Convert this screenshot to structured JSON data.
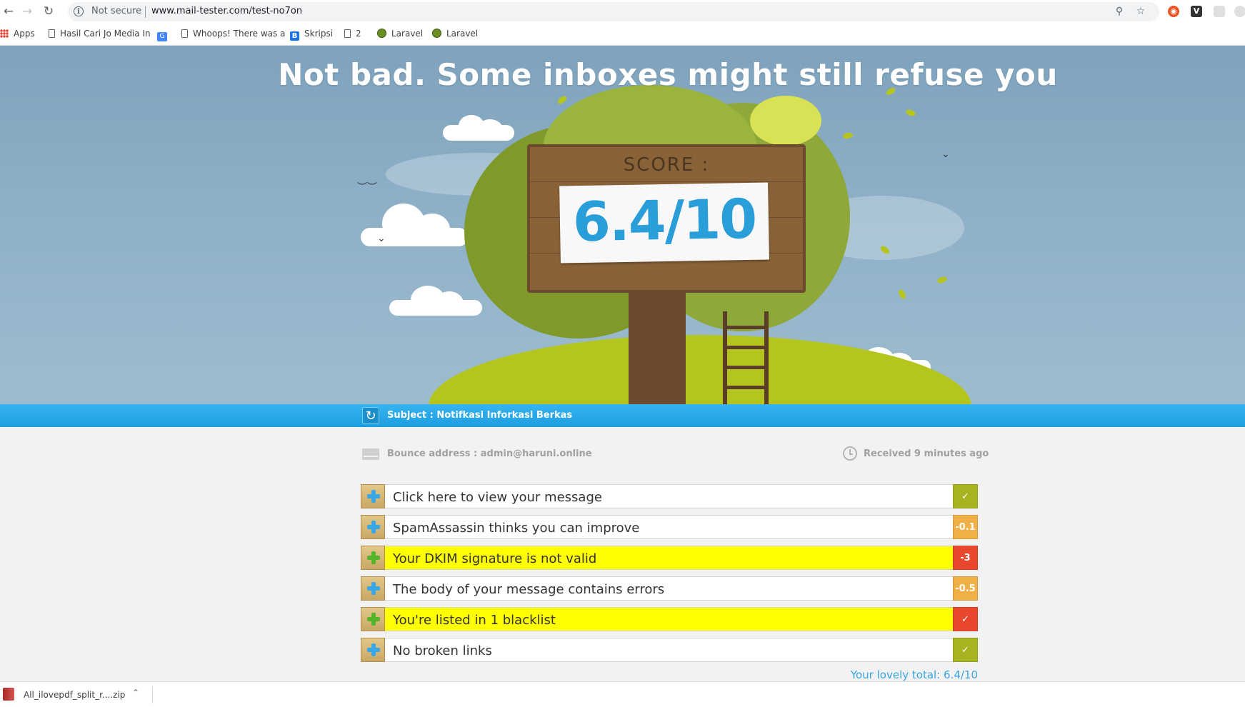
{
  "browser": {
    "security_label": "Not secure",
    "url": "www.mail-tester.com/test-no7on",
    "bookmarks": [
      {
        "label": "Apps",
        "icon": "apps-grid-icon"
      },
      {
        "label": "Hasil Cari Jo Media In",
        "icon": "page-icon"
      },
      {
        "label": "",
        "icon": "google-translate-icon"
      },
      {
        "label": "Whoops! There was a",
        "icon": "page-icon"
      },
      {
        "label": "Skripsi",
        "icon": "blogger-icon"
      },
      {
        "label": "2",
        "icon": "page-icon"
      },
      {
        "label": "Laravel",
        "icon": "globe-icon"
      },
      {
        "label": "Laravel",
        "icon": "globe-icon"
      }
    ]
  },
  "hero": {
    "title": "Not bad. Some inboxes might still refuse you",
    "score_label": "SCORE :",
    "score_value": "6.4/10"
  },
  "subject": {
    "text": "Subject : Notifkasi Inforkasi Berkas"
  },
  "info": {
    "bounce": "Bounce address : admin@haruni.online",
    "received": "Received 9 minutes ago"
  },
  "results": [
    {
      "label": "Click here to view your message",
      "badge": "✓",
      "badge_color": "#a8b41f",
      "highlighted": false
    },
    {
      "label": "SpamAssassin thinks you can improve",
      "badge": "-0.1",
      "badge_color": "#f0b046",
      "highlighted": false
    },
    {
      "label": "Your DKIM signature is not valid",
      "badge": "-3",
      "badge_color": "#e8472e",
      "highlighted": true
    },
    {
      "label": "The body of your message contains errors",
      "badge": "-0.5",
      "badge_color": "#f0b046",
      "highlighted": false
    },
    {
      "label": "You're listed in 1 blacklist",
      "badge": "✓",
      "badge_color": "#e8472e",
      "highlighted": true
    },
    {
      "label": "No broken links",
      "badge": "✓",
      "badge_color": "#a8b41f",
      "highlighted": false
    }
  ],
  "total": "Your lovely total: 6.4/10",
  "downloads": {
    "file": "All_ilovepdf_split_r....zip"
  },
  "colors": {
    "accent_blue": "#2a9ed9",
    "highlight": "#ffff00"
  }
}
